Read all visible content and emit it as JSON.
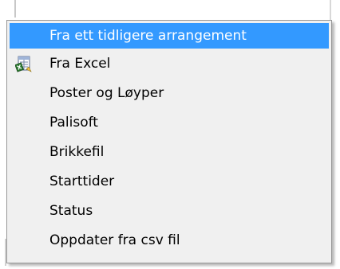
{
  "menu": {
    "items": [
      {
        "label": "Fra ett tidligere arrangement",
        "highlighted": true,
        "icon": ""
      },
      {
        "label": "Fra Excel",
        "highlighted": false,
        "icon": "excel-icon"
      },
      {
        "label": "Poster og Løyper",
        "highlighted": false,
        "icon": ""
      },
      {
        "label": "Palisoft",
        "highlighted": false,
        "icon": ""
      },
      {
        "label": "Brikkefil",
        "highlighted": false,
        "icon": ""
      },
      {
        "label": "Starttider",
        "highlighted": false,
        "icon": ""
      },
      {
        "label": "Status",
        "highlighted": false,
        "icon": ""
      },
      {
        "label": "Oppdater fra csv fil",
        "highlighted": false,
        "icon": ""
      }
    ]
  },
  "colors": {
    "highlight": "#3399ff",
    "menu_background": "#f0f0f0",
    "border": "#979797"
  }
}
